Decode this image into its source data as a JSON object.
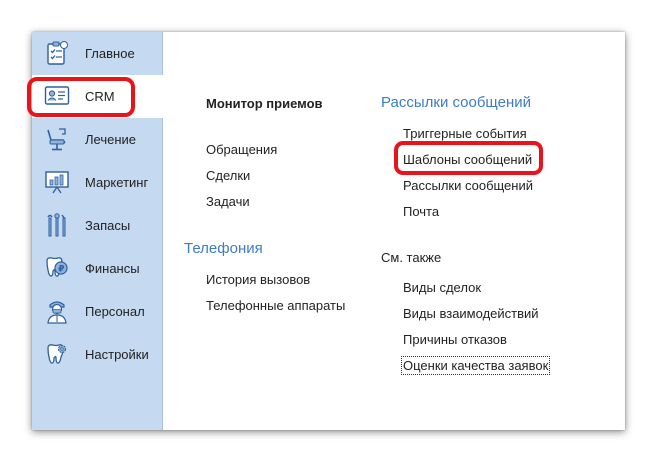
{
  "sidebar": {
    "items": [
      {
        "label": "Главное",
        "icon": "checklist-icon"
      },
      {
        "label": "CRM",
        "icon": "contact-card-icon",
        "active": true
      },
      {
        "label": "Лечение",
        "icon": "dental-chair-icon"
      },
      {
        "label": "Маркетинг",
        "icon": "presentation-chart-icon"
      },
      {
        "label": "Запасы",
        "icon": "dental-tools-icon"
      },
      {
        "label": "Финансы",
        "icon": "tooth-coin-icon"
      },
      {
        "label": "Персонал",
        "icon": "doctor-icon"
      },
      {
        "label": "Настройки",
        "icon": "tooth-gear-icon"
      }
    ]
  },
  "content": {
    "col1": {
      "monitor": "Монитор приемов",
      "links": [
        "Обращения",
        "Сделки",
        "Задачи"
      ],
      "telephony_title": "Телефония",
      "telephony_links": [
        "История вызовов",
        "Телефонные аппараты"
      ]
    },
    "col2": {
      "mailings_title": "Рассылки сообщений",
      "mailings_links": [
        "Триггерные события",
        "Шаблоны сообщений",
        "Рассылки сообщений",
        "Почта"
      ],
      "see_also_title": "См. также",
      "see_also_links": [
        "Виды сделок",
        "Виды взаимодействий",
        "Причины отказов",
        "Оценки качества заявок"
      ]
    }
  },
  "colors": {
    "sidebar_bg": "#c5d9f1",
    "accent_blue": "#3d7cc9",
    "highlight_red": "#e8141b"
  }
}
